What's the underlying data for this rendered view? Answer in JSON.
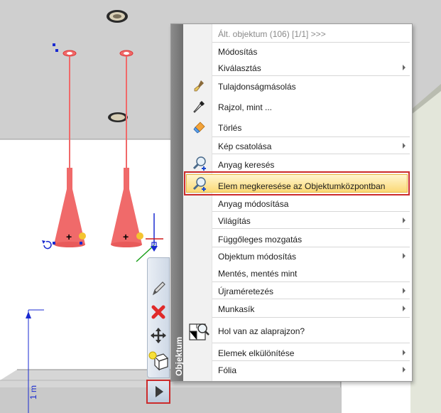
{
  "scene": {
    "ruler_label": "1 m"
  },
  "context_menu": {
    "side_label": "Objektum",
    "header": "Ált. objektum (106) [1/1] >>>",
    "items": [
      {
        "label": "Módosítás",
        "submenu": false
      },
      {
        "label": "Kiválasztás",
        "submenu": true
      },
      {
        "label": "Tulajdonságmásolás",
        "submenu": false,
        "icon": "brush-icon"
      },
      {
        "label": "Rajzol, mint ...",
        "submenu": false,
        "icon": "eyedropper-icon"
      },
      {
        "label": "Törlés",
        "submenu": false,
        "icon": "eraser-icon"
      },
      {
        "label": "Kép csatolása",
        "submenu": true
      },
      {
        "label": "Anyag keresés",
        "submenu": false,
        "icon": "magnifier-plus-icon"
      },
      {
        "label": "Elem megkeresése az Objektumközpontban",
        "submenu": false,
        "icon": "magnifier-plus-icon",
        "highlighted": true
      },
      {
        "label": "Anyag módosítása",
        "submenu": false
      },
      {
        "label": "Világítás",
        "submenu": true
      },
      {
        "label": "Függőleges mozgatás",
        "submenu": false
      },
      {
        "label": "Objektum módosítás",
        "submenu": true
      },
      {
        "label": "Mentés, mentés mint",
        "submenu": false
      },
      {
        "label": "Újraméretezés",
        "submenu": true
      },
      {
        "label": "Munkasík",
        "submenu": true
      },
      {
        "label": "Hol van az alaprajzon?",
        "submenu": false,
        "icon": "floorplan-search-icon"
      },
      {
        "label": "Elemek elkülönítése",
        "submenu": true
      },
      {
        "label": "Fólia",
        "submenu": true
      }
    ]
  },
  "colors": {
    "highlight_border": "#cc2b2b",
    "highlight_fill": "#fbd976",
    "lamp_red": "#f06a6a",
    "ceiling_gray": "#cfcfcf"
  }
}
